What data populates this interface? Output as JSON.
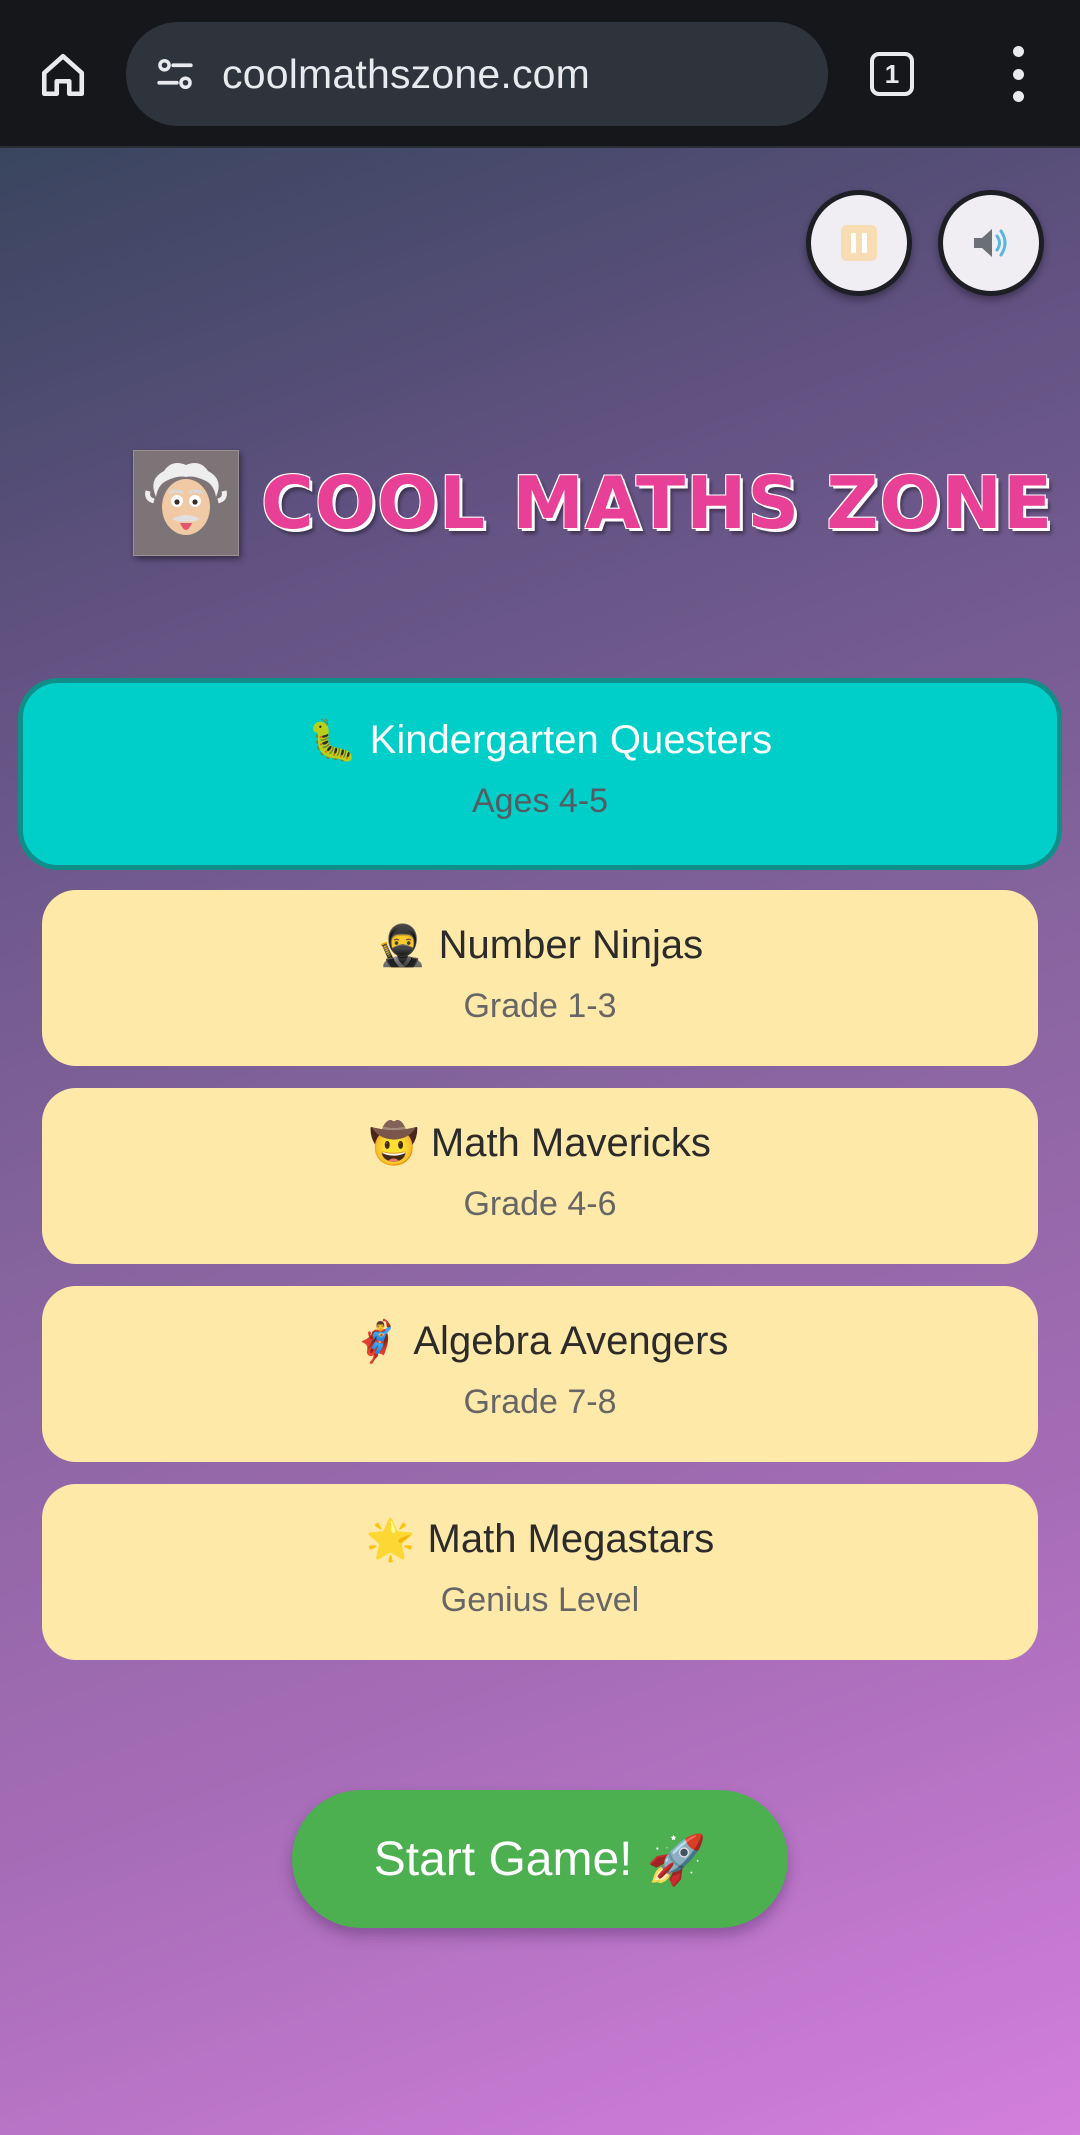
{
  "browser": {
    "url": "coolmathszone.com",
    "tab_count": "1",
    "icons": [
      "home-icon",
      "site-settings-icon",
      "tabs-icon",
      "more-menu-icon"
    ]
  },
  "controls": {
    "pause_icon": "pause-icon",
    "sound_icon": "speaker-icon"
  },
  "header": {
    "title": "COOL MATHS ZONE",
    "logo": "einstein-logo"
  },
  "levels": [
    {
      "emoji": "🐛",
      "label": "Kindergarten Questers",
      "sub": "Ages 4-5",
      "selected": true
    },
    {
      "emoji": "🥷",
      "label": "Number Ninjas",
      "sub": "Grade 1-3",
      "selected": false
    },
    {
      "emoji": "🤠",
      "label": "Math Mavericks",
      "sub": "Grade 4-6",
      "selected": false
    },
    {
      "emoji": "🦸‍♂️",
      "label": "Algebra Avengers",
      "sub": "Grade 7-8",
      "selected": false
    },
    {
      "emoji": "🌟",
      "label": "Math Megastars",
      "sub": "Genius Level",
      "selected": false
    }
  ],
  "start_button": {
    "label": "Start Game!",
    "emoji": "🚀"
  },
  "colors": {
    "selected_card": "#00cec9",
    "card": "#ffe9a8",
    "start_button": "#4caf50",
    "title": "#e83f97"
  }
}
